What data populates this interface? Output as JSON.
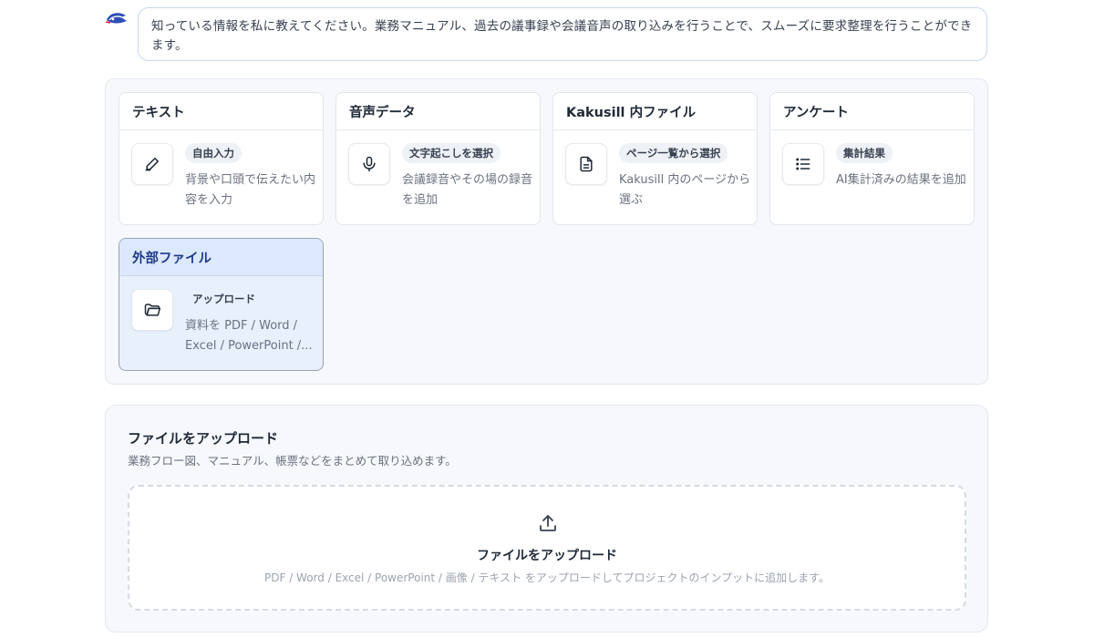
{
  "assistant": {
    "avatar_icon": "assistant-logo-icon",
    "message": "知っている情報を私に教えてください。業務マニュアル、過去の議事録や会議音声の取り込みを行うことで、スムーズに要求整理を行うことができます。"
  },
  "input_options": [
    {
      "title": "テキスト",
      "icon": "pencil-icon",
      "tag": "自由入力",
      "description": "背景や口頭で伝えたい内容を入力",
      "selected": false
    },
    {
      "title": "音声データ",
      "icon": "microphone-icon",
      "tag": "文字起こしを選択",
      "description": "会議録音やその場の録音を追加",
      "selected": false
    },
    {
      "title": "Kakusill 内ファイル",
      "icon": "document-icon",
      "tag": "ページ一覧から選択",
      "description": "Kakusill 内のページから選ぶ",
      "selected": false
    },
    {
      "title": "アンケート",
      "icon": "list-icon",
      "tag": "集計結果",
      "description": "AI集計済みの結果を追加",
      "selected": false
    },
    {
      "title": "外部ファイル",
      "icon": "folder-icon",
      "tag": "アップロード",
      "description": "資料を PDF / Word / Excel / PowerPoint /...",
      "selected": true
    }
  ],
  "upload": {
    "title": "ファイルをアップロード",
    "subtitle": "業務フロー図、マニュアル、帳票などをまとめて取り込めます。",
    "dropzone_icon": "upload-icon",
    "dropzone_label": "ファイルをアップロード",
    "dropzone_hint": "PDF / Word / Excel / PowerPoint / 画像 / テキスト をアップロードしてプロジェクトのインプットに追加します。"
  },
  "colors": {
    "selected_card_bg": "#e8f0fc",
    "selected_card_header": "#dce8fb",
    "accent_text": "#1e3a8a"
  }
}
